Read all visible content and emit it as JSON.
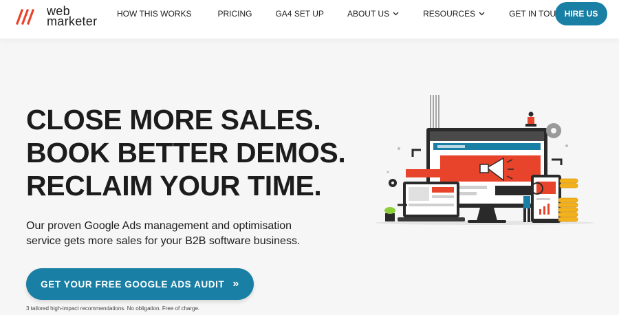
{
  "logo": {
    "line1": "web",
    "line2": "marketer",
    "accent": "#e8432b"
  },
  "nav": {
    "items": [
      {
        "label": "HOW THIS WORKS",
        "dropdown": false
      },
      {
        "label": "PRICING",
        "dropdown": false
      },
      {
        "label": "GA4 SET UP",
        "dropdown": false
      },
      {
        "label": "ABOUT US",
        "dropdown": true
      },
      {
        "label": "RESOURCES",
        "dropdown": true
      },
      {
        "label": "GET IN TOUCH",
        "dropdown": false
      }
    ],
    "hire_label": "HIRE US"
  },
  "hero": {
    "headline": [
      "CLOSE MORE SALES.",
      "BOOK BETTER DEMOS.",
      "RECLAIM YOUR TIME."
    ],
    "subtext": "Our proven Google Ads management and optimisation service gets more sales for your B2B software business.",
    "cta_label": "GET YOUR FREE GOOGLE ADS AUDIT",
    "cta_icon": "double-chevron-right-icon",
    "note": "3 tailored high-impact recommendations. No obligation. Free of charge.",
    "illustration": "digital-marketing-illustration"
  },
  "colors": {
    "primary": "#1a7fa4",
    "accent": "#e8432b",
    "background": "#f6f6f6",
    "text": "#1d1d1d"
  }
}
